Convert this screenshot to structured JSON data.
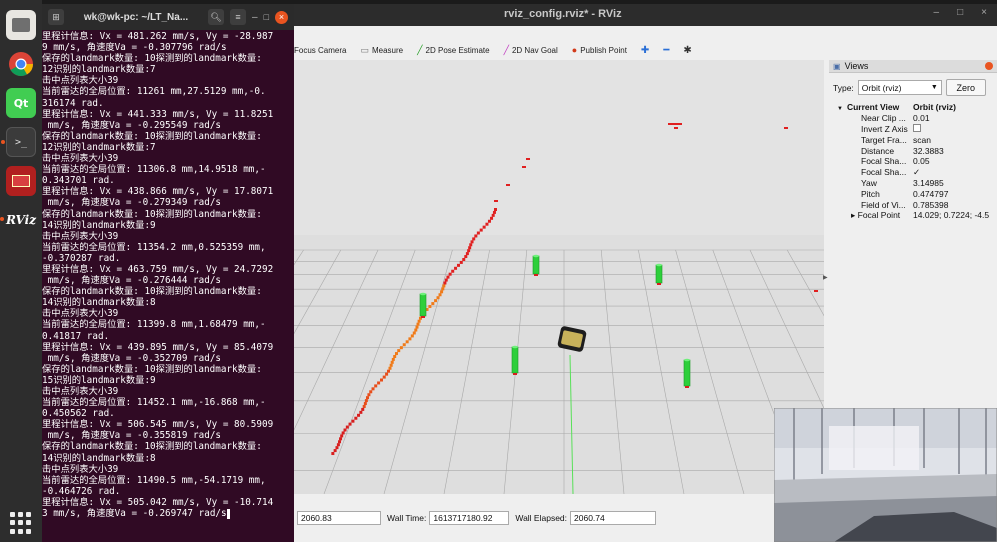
{
  "terminal": {
    "title": "wk@wk-pc: ~/LT_Na...",
    "lines": [
      "里程计信息: Vx = 481.262 mm/s, Vy = -28.987",
      "9 mm/s, 角速度Va = -0.307796 rad/s",
      "保存的landmark数量: 10探测到的landmark数量:",
      "12识别的landmark数量:7",
      "击中点列表大小39",
      "当前雷达的全局位置: 11261 mm,27.5129 mm,-0.",
      "316174 rad.",
      "里程计信息: Vx = 441.333 mm/s, Vy = 11.8251",
      " mm/s, 角速度Va = -0.295549 rad/s",
      "保存的landmark数量: 10探测到的landmark数量:",
      "12识别的landmark数量:7",
      "击中点列表大小39",
      "当前雷达的全局位置: 11306.8 mm,14.9518 mm,-",
      "0.343701 rad.",
      "里程计信息: Vx = 438.866 mm/s, Vy = 17.8071",
      " mm/s, 角速度Va = -0.279349 rad/s",
      "保存的landmark数量: 10探测到的landmark数量:",
      "14识别的landmark数量:9",
      "击中点列表大小39",
      "当前雷达的全局位置: 11354.2 mm,0.525359 mm,",
      "-0.370287 rad.",
      "里程计信息: Vx = 463.759 mm/s, Vy = 24.7292",
      " mm/s, 角速度Va = -0.276444 rad/s",
      "保存的landmark数量: 10探测到的landmark数量:",
      "14识别的landmark数量:8",
      "击中点列表大小39",
      "当前雷达的全局位置: 11399.8 mm,1.68479 mm,-",
      "0.41817 rad.",
      "里程计信息: Vx = 439.895 mm/s, Vy = 85.4079",
      " mm/s, 角速度Va = -0.352709 rad/s",
      "保存的landmark数量: 10探测到的landmark数量:",
      "15识别的landmark数量:9",
      "击中点列表大小39",
      "当前雷达的全局位置: 11452.1 mm,-16.868 mm,-",
      "0.450562 rad.",
      "里程计信息: Vx = 506.545 mm/s, Vy = 80.5909",
      " mm/s, 角速度Va = -0.355819 rad/s",
      "保存的landmark数量: 10探测到的landmark数量:",
      "14识别的landmark数量:8",
      "击中点列表大小39",
      "当前雷达的全局位置: 11490.5 mm,-54.1719 mm,",
      "-0.464726 rad.",
      "里程计信息: Vx = 505.042 mm/s, Vy = -10.714",
      "3 mm/s, 角速度Va = -0.269747 rad/s"
    ]
  },
  "dock": {
    "qt_label": "Qt",
    "term_label": ">_",
    "rviz_label": "RViz"
  },
  "rviz": {
    "title": "rviz_config.rviz* - RViz",
    "toolbar": {
      "focus_camera": "Focus Camera",
      "measure": "Measure",
      "pose_estimate": "2D Pose Estimate",
      "nav_goal": "2D Nav Goal",
      "publish_point": "Publish Point"
    },
    "views": {
      "header": "Views",
      "type_label": "Type:",
      "type_value": "Orbit (rviz)",
      "zero_label": "Zero",
      "current_view_key": "Current View",
      "current_view_val": "Orbit (rviz)",
      "props": [
        {
          "key": "Near Clip ...",
          "val": "0.01"
        },
        {
          "key": "Invert Z Axis",
          "val": ""
        },
        {
          "key": "Target Fra...",
          "val": "scan"
        },
        {
          "key": "Distance",
          "val": "32.3883"
        },
        {
          "key": "Focal Sha...",
          "val": "0.05"
        },
        {
          "key": "Focal Sha...",
          "val": "✓"
        },
        {
          "key": "Yaw",
          "val": "3.14985"
        },
        {
          "key": "Pitch",
          "val": "0.474797"
        },
        {
          "key": "Field of Vi...",
          "val": "0.785398"
        },
        {
          "key": "Focal Point",
          "val": "14.029; 0.7224; -4.5"
        }
      ]
    },
    "time": {
      "ros_time_value": "2060.83",
      "wall_time_label": "Wall Time:",
      "wall_time_value": "1613717180.92",
      "wall_elapsed_label": "Wall Elapsed:",
      "wall_elapsed_value": "2060.74"
    }
  }
}
